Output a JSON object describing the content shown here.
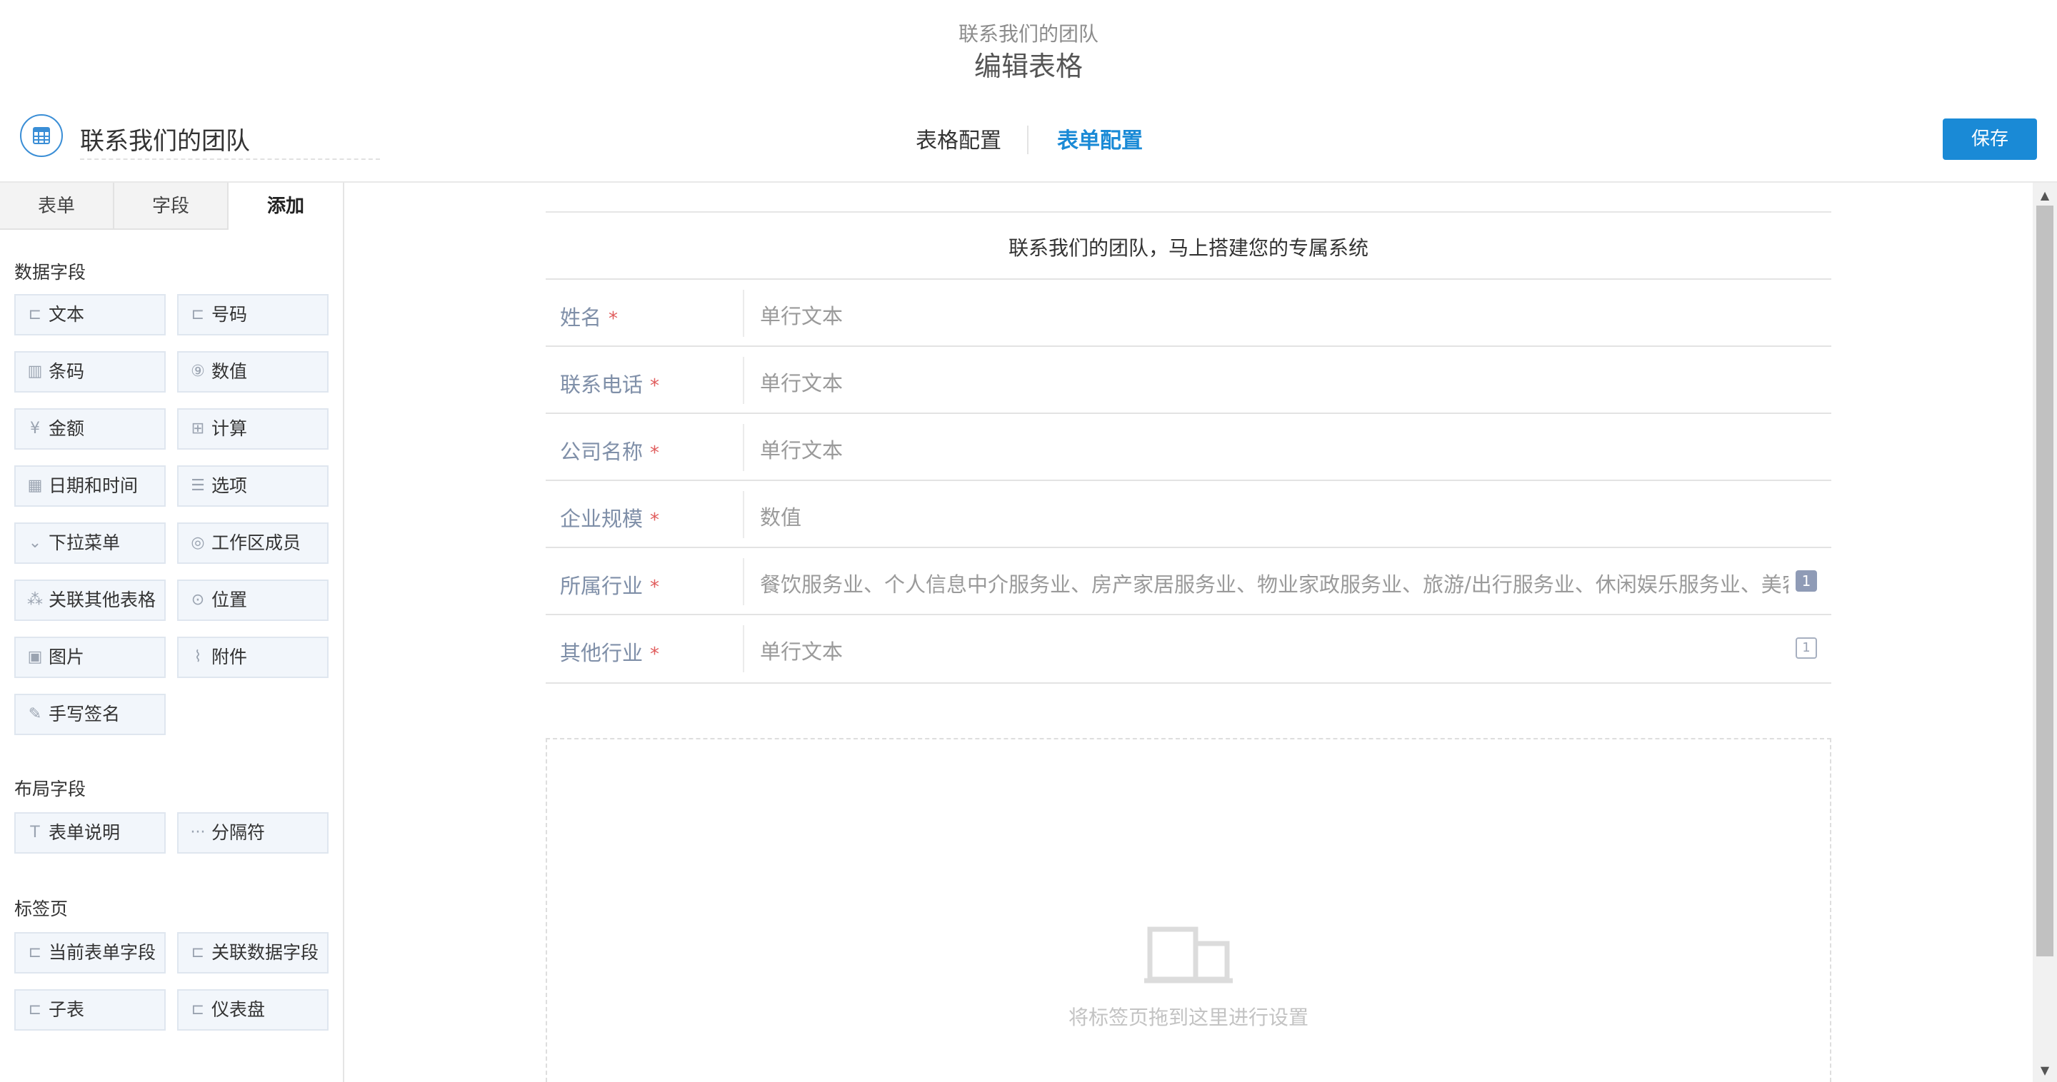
{
  "window": {
    "subtitle": "联系我们的团队",
    "title": "编辑表格"
  },
  "header": {
    "app_name": "联系我们的团队",
    "tabs": [
      {
        "label": "表格配置",
        "active": false
      },
      {
        "label": "表单配置",
        "active": true
      }
    ],
    "save_label": "保存",
    "accent_color": "#1a8ad6"
  },
  "sidebar": {
    "tabs": [
      {
        "label": "表单",
        "active": false
      },
      {
        "label": "字段",
        "active": false
      },
      {
        "label": "添加",
        "active": true
      }
    ],
    "sections": [
      {
        "title": "数据字段",
        "items": [
          {
            "label": "文本",
            "icon": "text-field-icon"
          },
          {
            "label": "号码",
            "icon": "number-field-icon"
          },
          {
            "label": "条码",
            "icon": "barcode-icon"
          },
          {
            "label": "数值",
            "icon": "numeric-icon"
          },
          {
            "label": "金额",
            "icon": "currency-icon"
          },
          {
            "label": "计算",
            "icon": "calculator-icon"
          },
          {
            "label": "日期和时间",
            "icon": "calendar-icon"
          },
          {
            "label": "选项",
            "icon": "list-icon"
          },
          {
            "label": "下拉菜单",
            "icon": "dropdown-icon"
          },
          {
            "label": "工作区成员",
            "icon": "member-icon"
          },
          {
            "label": "关联其他表格",
            "icon": "hierarchy-icon"
          },
          {
            "label": "位置",
            "icon": "location-icon"
          },
          {
            "label": "图片",
            "icon": "image-icon"
          },
          {
            "label": "附件",
            "icon": "attachment-icon"
          },
          {
            "label": "手写签名",
            "icon": "signature-icon"
          }
        ]
      },
      {
        "title": "布局字段",
        "items": [
          {
            "label": "表单说明",
            "icon": "text-type-icon"
          },
          {
            "label": "分隔符",
            "icon": "ellipsis-icon"
          }
        ]
      },
      {
        "title": "标签页",
        "items": [
          {
            "label": "当前表单字段",
            "icon": "tab-page-icon"
          },
          {
            "label": "关联数据字段",
            "icon": "tab-page-icon"
          },
          {
            "label": "子表",
            "icon": "tab-page-icon"
          },
          {
            "label": "仪表盘",
            "icon": "tab-page-icon"
          }
        ]
      }
    ]
  },
  "form": {
    "title": "联系我们的团队，马上搭建您的专属系统",
    "required_mark": "*",
    "rows": [
      {
        "label": "姓名",
        "value": "单行文本",
        "badge": ""
      },
      {
        "label": "联系电话",
        "value": "单行文本",
        "badge": ""
      },
      {
        "label": "公司名称",
        "value": "单行文本",
        "badge": ""
      },
      {
        "label": "企业规模",
        "value": "数值",
        "badge": ""
      },
      {
        "label": "所属行业",
        "value": "餐饮服务业、个人信息中介服务业、房产家居服务业、物业家政服务业、旅游/出行服务业、休闲娱乐服务业、美容美",
        "badge": "1"
      },
      {
        "label": "其他行业",
        "value": "单行文本",
        "badge": "1"
      }
    ],
    "tabs_placeholder": "将标签页拖到这里进行设置"
  }
}
